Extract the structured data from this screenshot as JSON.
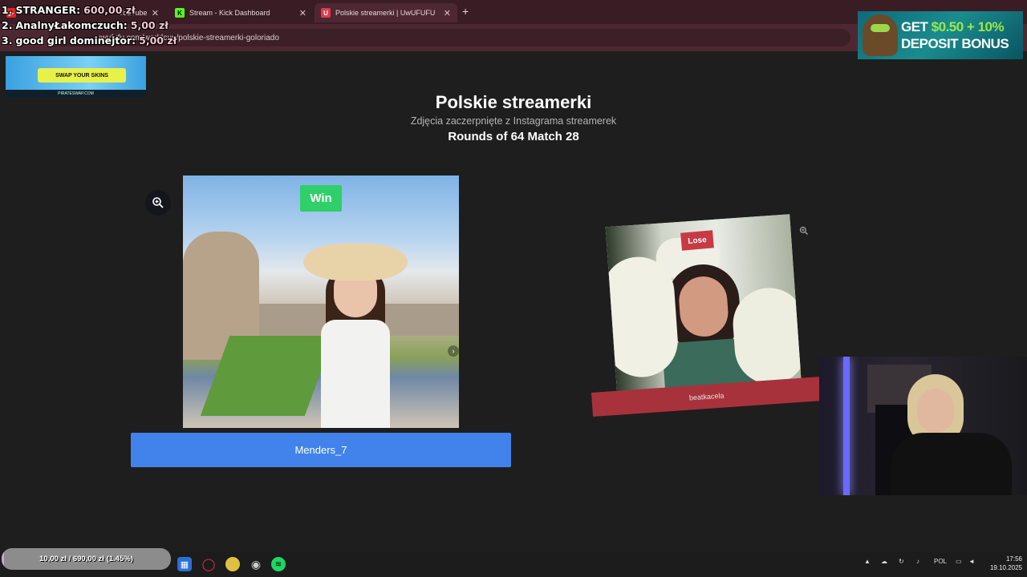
{
  "browser": {
    "tabs": [
      {
        "title": "YouTube",
        "icon": "youtube-icon"
      },
      {
        "title": "Stream - Kick Dashboard",
        "icon": "kick-icon"
      },
      {
        "title": "Polskie streamerki | UwUFUFU",
        "icon": "uwufufu-icon"
      }
    ],
    "url": "uwufufu.com/worldcup/polskie-streamerki-goloriado"
  },
  "donations": [
    {
      "rank": "1.",
      "name": "STRANGER:",
      "amount": "600,00 zł"
    },
    {
      "rank": "2.",
      "name": "AnalnyŁakomczuch:",
      "amount": "5,00 zł"
    },
    {
      "rank": "3.",
      "name": "good girl dominejtor:",
      "amount": "5,00 zł"
    }
  ],
  "ads": {
    "left": {
      "label": "SWAP YOUR SKINS",
      "site": "PIRATESWAP.COM"
    },
    "right": {
      "line1_prefix": "GET ",
      "line1_highlight": "$0.50 + 10%",
      "line2": "DEPOSIT BONUS"
    }
  },
  "page": {
    "title": "Polskie streamerki",
    "subtitle": "Zdjęcia zaczerpnięte z Instagrama streamerek",
    "round": "Rounds of 64 Match 28"
  },
  "left_candidate": {
    "badge": "Win",
    "name": "Menders_7"
  },
  "right_candidate": {
    "badge": "Lose",
    "name": "beatkacela"
  },
  "goal": {
    "current": "10,00 zł",
    "target": "690,00 zł",
    "percent": "(1.45%)",
    "fraction": 0.0145
  },
  "taskbar": {
    "language": "POL",
    "time": "17:56",
    "date": "19.10.2025"
  },
  "colors": {
    "win": "#2fcf6a",
    "lose": "#c73a44",
    "name_button": "#4183ea"
  }
}
